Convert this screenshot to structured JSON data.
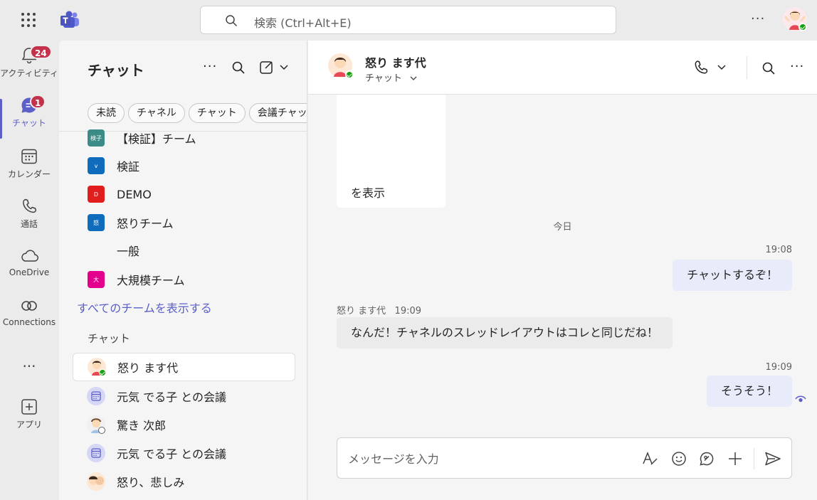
{
  "search": {
    "placeholder": "検索 (Ctrl+Alt+E)"
  },
  "rail": {
    "items": [
      {
        "id": "activity",
        "label": "アクティビティ",
        "badge": "24"
      },
      {
        "id": "chat",
        "label": "チャット",
        "badge": "1"
      },
      {
        "id": "calendar",
        "label": "カレンダー"
      },
      {
        "id": "calls",
        "label": "通話"
      },
      {
        "id": "onedrive",
        "label": "OneDrive"
      },
      {
        "id": "connections",
        "label": "Connections"
      },
      {
        "id": "apps",
        "label": "アプリ"
      }
    ],
    "more": "..."
  },
  "chatlist": {
    "title": "チャット",
    "more": "···",
    "filters": [
      "未読",
      "チャネル",
      "チャット",
      "会議チャット"
    ],
    "teams": [
      {
        "abbr": "検子",
        "name": "【検証】チーム",
        "color": "#3b8c87"
      },
      {
        "abbr": "v",
        "name": "検証",
        "color": "#0f6cbd"
      },
      {
        "abbr": "D",
        "name": "DEMO",
        "color": "#d13438"
      },
      {
        "abbr": "怒",
        "name": "怒りチーム",
        "color": "#0f6cbd"
      },
      {
        "abbr": "大",
        "name": "大規模チーム",
        "color": "#e3008c"
      }
    ],
    "channel": "一般",
    "all_teams_link": "すべてのチームを表示する",
    "section": "チャット",
    "chats": [
      {
        "name": "怒り ます代"
      },
      {
        "name": "元気 でる子 との会議"
      },
      {
        "name": "驚き 次郎"
      },
      {
        "name": "元気 でる子 との会議"
      },
      {
        "name": "怒り、悲しみ"
      }
    ]
  },
  "conversation": {
    "name": "怒り ます代",
    "subtitle": "チャット",
    "more": "···",
    "old_card_text": "を表示",
    "date_sep": "今日",
    "messages": [
      {
        "from": "me",
        "time": "19:08",
        "text": "チャットするぞ！"
      },
      {
        "from": "them",
        "sender": "怒り ます代",
        "time": "19:09",
        "text": "なんだ！チャネルのスレッドレイアウトはコレと同じだね！"
      },
      {
        "from": "me",
        "time": "19:09",
        "text": "そうそう！"
      }
    ],
    "composer_placeholder": "メッセージを入力"
  },
  "colors": {
    "accent": "#5b5fc7",
    "badge": "#c4314b",
    "presence": "#13a10e"
  }
}
